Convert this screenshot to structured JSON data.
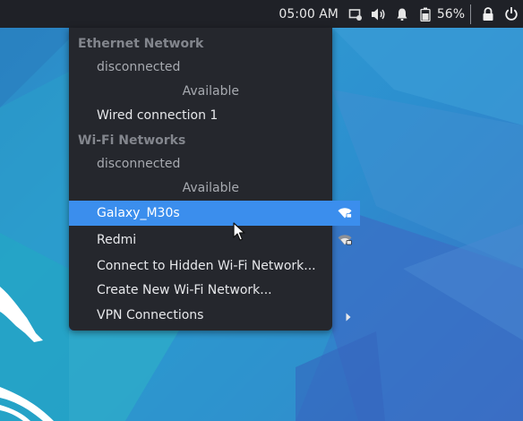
{
  "panel": {
    "clock": "05:00 AM",
    "battery_percent": "56%",
    "icons": [
      "screen-recorder-icon",
      "speaker-volume-icon",
      "notification-bell-icon",
      "battery-icon",
      "lock-icon",
      "power-icon"
    ]
  },
  "network_menu": {
    "ethernet_header": "Ethernet Network",
    "ethernet_status": "disconnected",
    "ethernet_available": "Available",
    "wired_connection": "Wired connection 1",
    "wifi_header": "Wi-Fi Networks",
    "wifi_status": "disconnected",
    "wifi_available": "Available",
    "networks": [
      {
        "ssid": "Galaxy_M30s",
        "selected": true,
        "icon": "wifi-secured-icon"
      },
      {
        "ssid": "Redmi",
        "selected": false,
        "icon": "wifi-secured-icon"
      }
    ],
    "hidden_network": "Connect to Hidden Wi-Fi Network...",
    "new_network": "Create New Wi-Fi Network...",
    "vpn": "VPN Connections"
  },
  "colors": {
    "panel_bg": "#1f2127",
    "menu_bg": "#25272d",
    "highlight": "#3b8eed",
    "header_text": "#83868d"
  }
}
